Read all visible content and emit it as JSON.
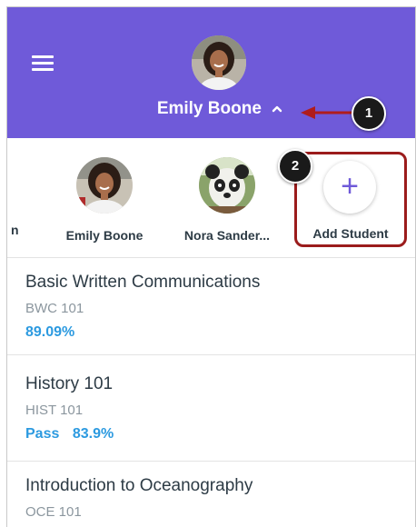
{
  "header": {
    "name": "Emily Boone",
    "background_color": "#6f5ad9",
    "menu_icon": "hamburger-menu-icon",
    "chevron_icon": "chevron-up-icon"
  },
  "callouts": [
    "1",
    "2"
  ],
  "student_strip": {
    "partial_label": "n",
    "students": [
      {
        "name": "Emily Boone",
        "avatar_icon": "student-photo-avatar"
      },
      {
        "name": "Nora Sander...",
        "avatar_icon": "panda-mascot-avatar"
      }
    ],
    "add_student": {
      "icon": "plus-icon",
      "symbol": "+",
      "label": "Add Student"
    }
  },
  "courses": [
    {
      "title": "Basic Written Communications",
      "code": "BWC 101",
      "grade_label": "",
      "grade": "89.09%"
    },
    {
      "title": "History 101",
      "code": "HIST 101",
      "grade_label": "Pass",
      "grade": "83.9%"
    },
    {
      "title": "Introduction to Oceanography",
      "code": "OCE 101",
      "grade_label": "",
      "grade": ""
    }
  ],
  "colors": {
    "accent": "#6f5ad9",
    "grade": "#2c9ae0",
    "highlight_border": "#9b1c1c",
    "arrow": "#b01c1c"
  }
}
